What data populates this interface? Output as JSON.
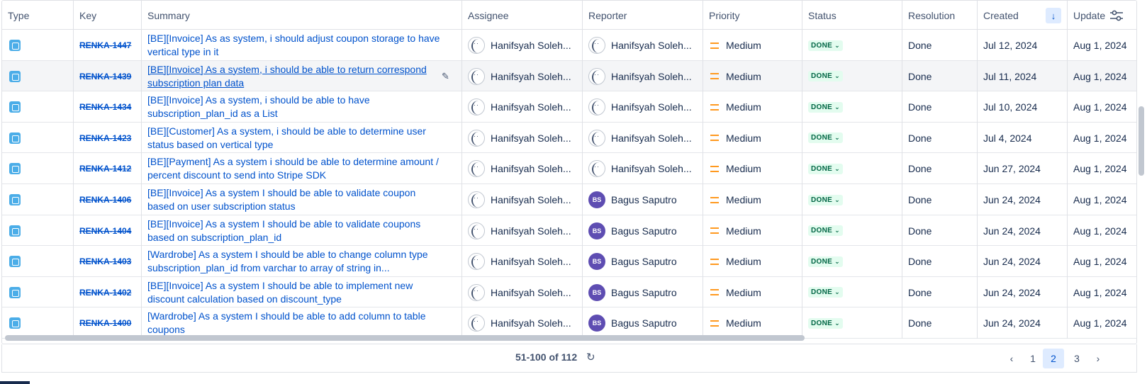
{
  "columns": {
    "type": "Type",
    "key": "Key",
    "summary": "Summary",
    "assignee": "Assignee",
    "reporter": "Reporter",
    "priority": "Priority",
    "status": "Status",
    "resolution": "Resolution",
    "created": "Created",
    "updated": "Update"
  },
  "rows": [
    {
      "key": "RENKA-1447",
      "summary": "[BE][Invoice] As as system, i should adjust coupon storage to have vertical type in it",
      "assignee": "Hanifsyah Soleh...",
      "reporter": "Hanifsyah Soleh...",
      "reporter_initials": "",
      "priority": "Medium",
      "status": "DONE",
      "resolution": "Done",
      "created": "Jul 12, 2024",
      "updated": "Aug 1, 2024"
    },
    {
      "key": "RENKA-1439",
      "summary": "[BE][Invoice] As a system, i should be able to return correspond subscription plan data",
      "assignee": "Hanifsyah Soleh...",
      "reporter": "Hanifsyah Soleh...",
      "reporter_initials": "",
      "priority": "Medium",
      "status": "DONE",
      "resolution": "Done",
      "created": "Jul 11, 2024",
      "updated": "Aug 1, 2024"
    },
    {
      "key": "RENKA-1434",
      "summary": "[BE][Invoice] As a system, i should be able to have subscription_plan_id as a List",
      "assignee": "Hanifsyah Soleh...",
      "reporter": "Hanifsyah Soleh...",
      "reporter_initials": "",
      "priority": "Medium",
      "status": "DONE",
      "resolution": "Done",
      "created": "Jul 10, 2024",
      "updated": "Aug 1, 2024"
    },
    {
      "key": "RENKA-1423",
      "summary": "[BE][Customer] As a system, i should be able to determine user status based on vertical type",
      "assignee": "Hanifsyah Soleh...",
      "reporter": "Hanifsyah Soleh...",
      "reporter_initials": "",
      "priority": "Medium",
      "status": "DONE",
      "resolution": "Done",
      "created": "Jul 4, 2024",
      "updated": "Aug 1, 2024"
    },
    {
      "key": "RENKA-1412",
      "summary": "[BE][Payment] As a system i should be able to determine amount / percent discount to send into Stripe SDK",
      "assignee": "Hanifsyah Soleh...",
      "reporter": "Hanifsyah Soleh...",
      "reporter_initials": "",
      "priority": "Medium",
      "status": "DONE",
      "resolution": "Done",
      "created": "Jun 27, 2024",
      "updated": "Aug 1, 2024"
    },
    {
      "key": "RENKA-1406",
      "summary": "[BE][Invoice] As a system I should be able to validate coupon based on user subscription status",
      "assignee": "Hanifsyah Soleh...",
      "reporter": "Bagus Saputro",
      "reporter_initials": "BS",
      "priority": "Medium",
      "status": "DONE",
      "resolution": "Done",
      "created": "Jun 24, 2024",
      "updated": "Aug 1, 2024"
    },
    {
      "key": "RENKA-1404",
      "summary": "[BE][Invoice] As a system I should be able to validate coupons based on subscription_plan_id",
      "assignee": "Hanifsyah Soleh...",
      "reporter": "Bagus Saputro",
      "reporter_initials": "BS",
      "priority": "Medium",
      "status": "DONE",
      "resolution": "Done",
      "created": "Jun 24, 2024",
      "updated": "Aug 1, 2024"
    },
    {
      "key": "RENKA-1403",
      "summary": "[Wardrobe] As a system I should be able to change column type subscription_plan_id from varchar to array of string in...",
      "assignee": "Hanifsyah Soleh...",
      "reporter": "Bagus Saputro",
      "reporter_initials": "BS",
      "priority": "Medium",
      "status": "DONE",
      "resolution": "Done",
      "created": "Jun 24, 2024",
      "updated": "Aug 1, 2024"
    },
    {
      "key": "RENKA-1402",
      "summary": "[BE][Invoice] As a system I should be able to implement new discount calculation based on discount_type",
      "assignee": "Hanifsyah Soleh...",
      "reporter": "Bagus Saputro",
      "reporter_initials": "BS",
      "priority": "Medium",
      "status": "DONE",
      "resolution": "Done",
      "created": "Jun 24, 2024",
      "updated": "Aug 1, 2024"
    },
    {
      "key": "RENKA-1400",
      "summary": "[Wardrobe] As a system I should be able to add column to table coupons",
      "assignee": "Hanifsyah Soleh...",
      "reporter": "Bagus Saputro",
      "reporter_initials": "BS",
      "priority": "Medium",
      "status": "DONE",
      "resolution": "Done",
      "created": "Jun 24, 2024",
      "updated": "Aug 1, 2024"
    }
  ],
  "highlighted_row": 1,
  "footer": {
    "count": "51-100 of 112",
    "pages": [
      "1",
      "2",
      "3"
    ],
    "current_page": "2"
  },
  "icons": {
    "type": "subtask-icon",
    "priority": "priority-medium-icon",
    "sort": "arrow-down-icon",
    "settings": "sliders-icon",
    "refresh": "refresh-icon"
  },
  "colors": {
    "link": "#0052cc",
    "priority_medium": "#ff991f",
    "status_done_bg": "#e3fcef",
    "status_done_text": "#006644",
    "avatar_bs": "#5e4db2",
    "active_page_bg": "#deebff"
  }
}
